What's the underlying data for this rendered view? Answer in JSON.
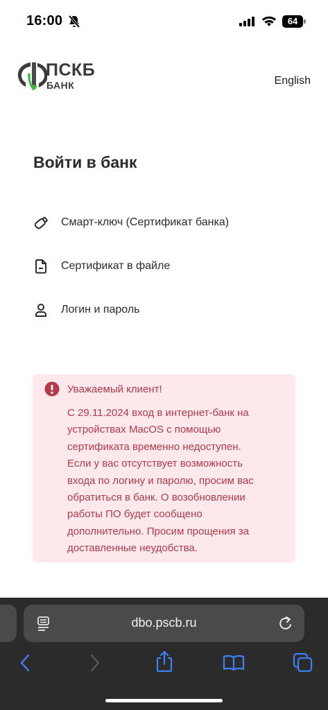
{
  "status": {
    "time": "16:00",
    "battery": "64"
  },
  "header": {
    "logo_text": "ПСКБ",
    "logo_sub": "БАНК",
    "language_link": "English"
  },
  "page": {
    "title": "Войти в банк"
  },
  "login_options": [
    {
      "label": "Смарт-ключ (Сертификат банка)",
      "icon": "usb-key-icon"
    },
    {
      "label": "Сертификат в файле",
      "icon": "file-icon"
    },
    {
      "label": "Логин и пароль",
      "icon": "user-icon"
    }
  ],
  "notice": {
    "heading": "Уважаемый клиент!",
    "lines": [
      "С 29.11.2024 вход в интернет-банк на",
      "устройствах MacOS с помощью",
      "сертификата временно недоступен.",
      "Если у вас отсутствует возможность",
      "входа по логину и паролю, просим вас",
      "обратиться в банк. О возобновлении",
      "работы ПО будет сообщено",
      "дополнительно. Просим прощения за",
      "доставленные неудобства."
    ],
    "color": "#b23a4a",
    "background": "#fde9ec"
  },
  "browser": {
    "url": "dbo.pscb.ru",
    "accent": "#3b82f6"
  }
}
